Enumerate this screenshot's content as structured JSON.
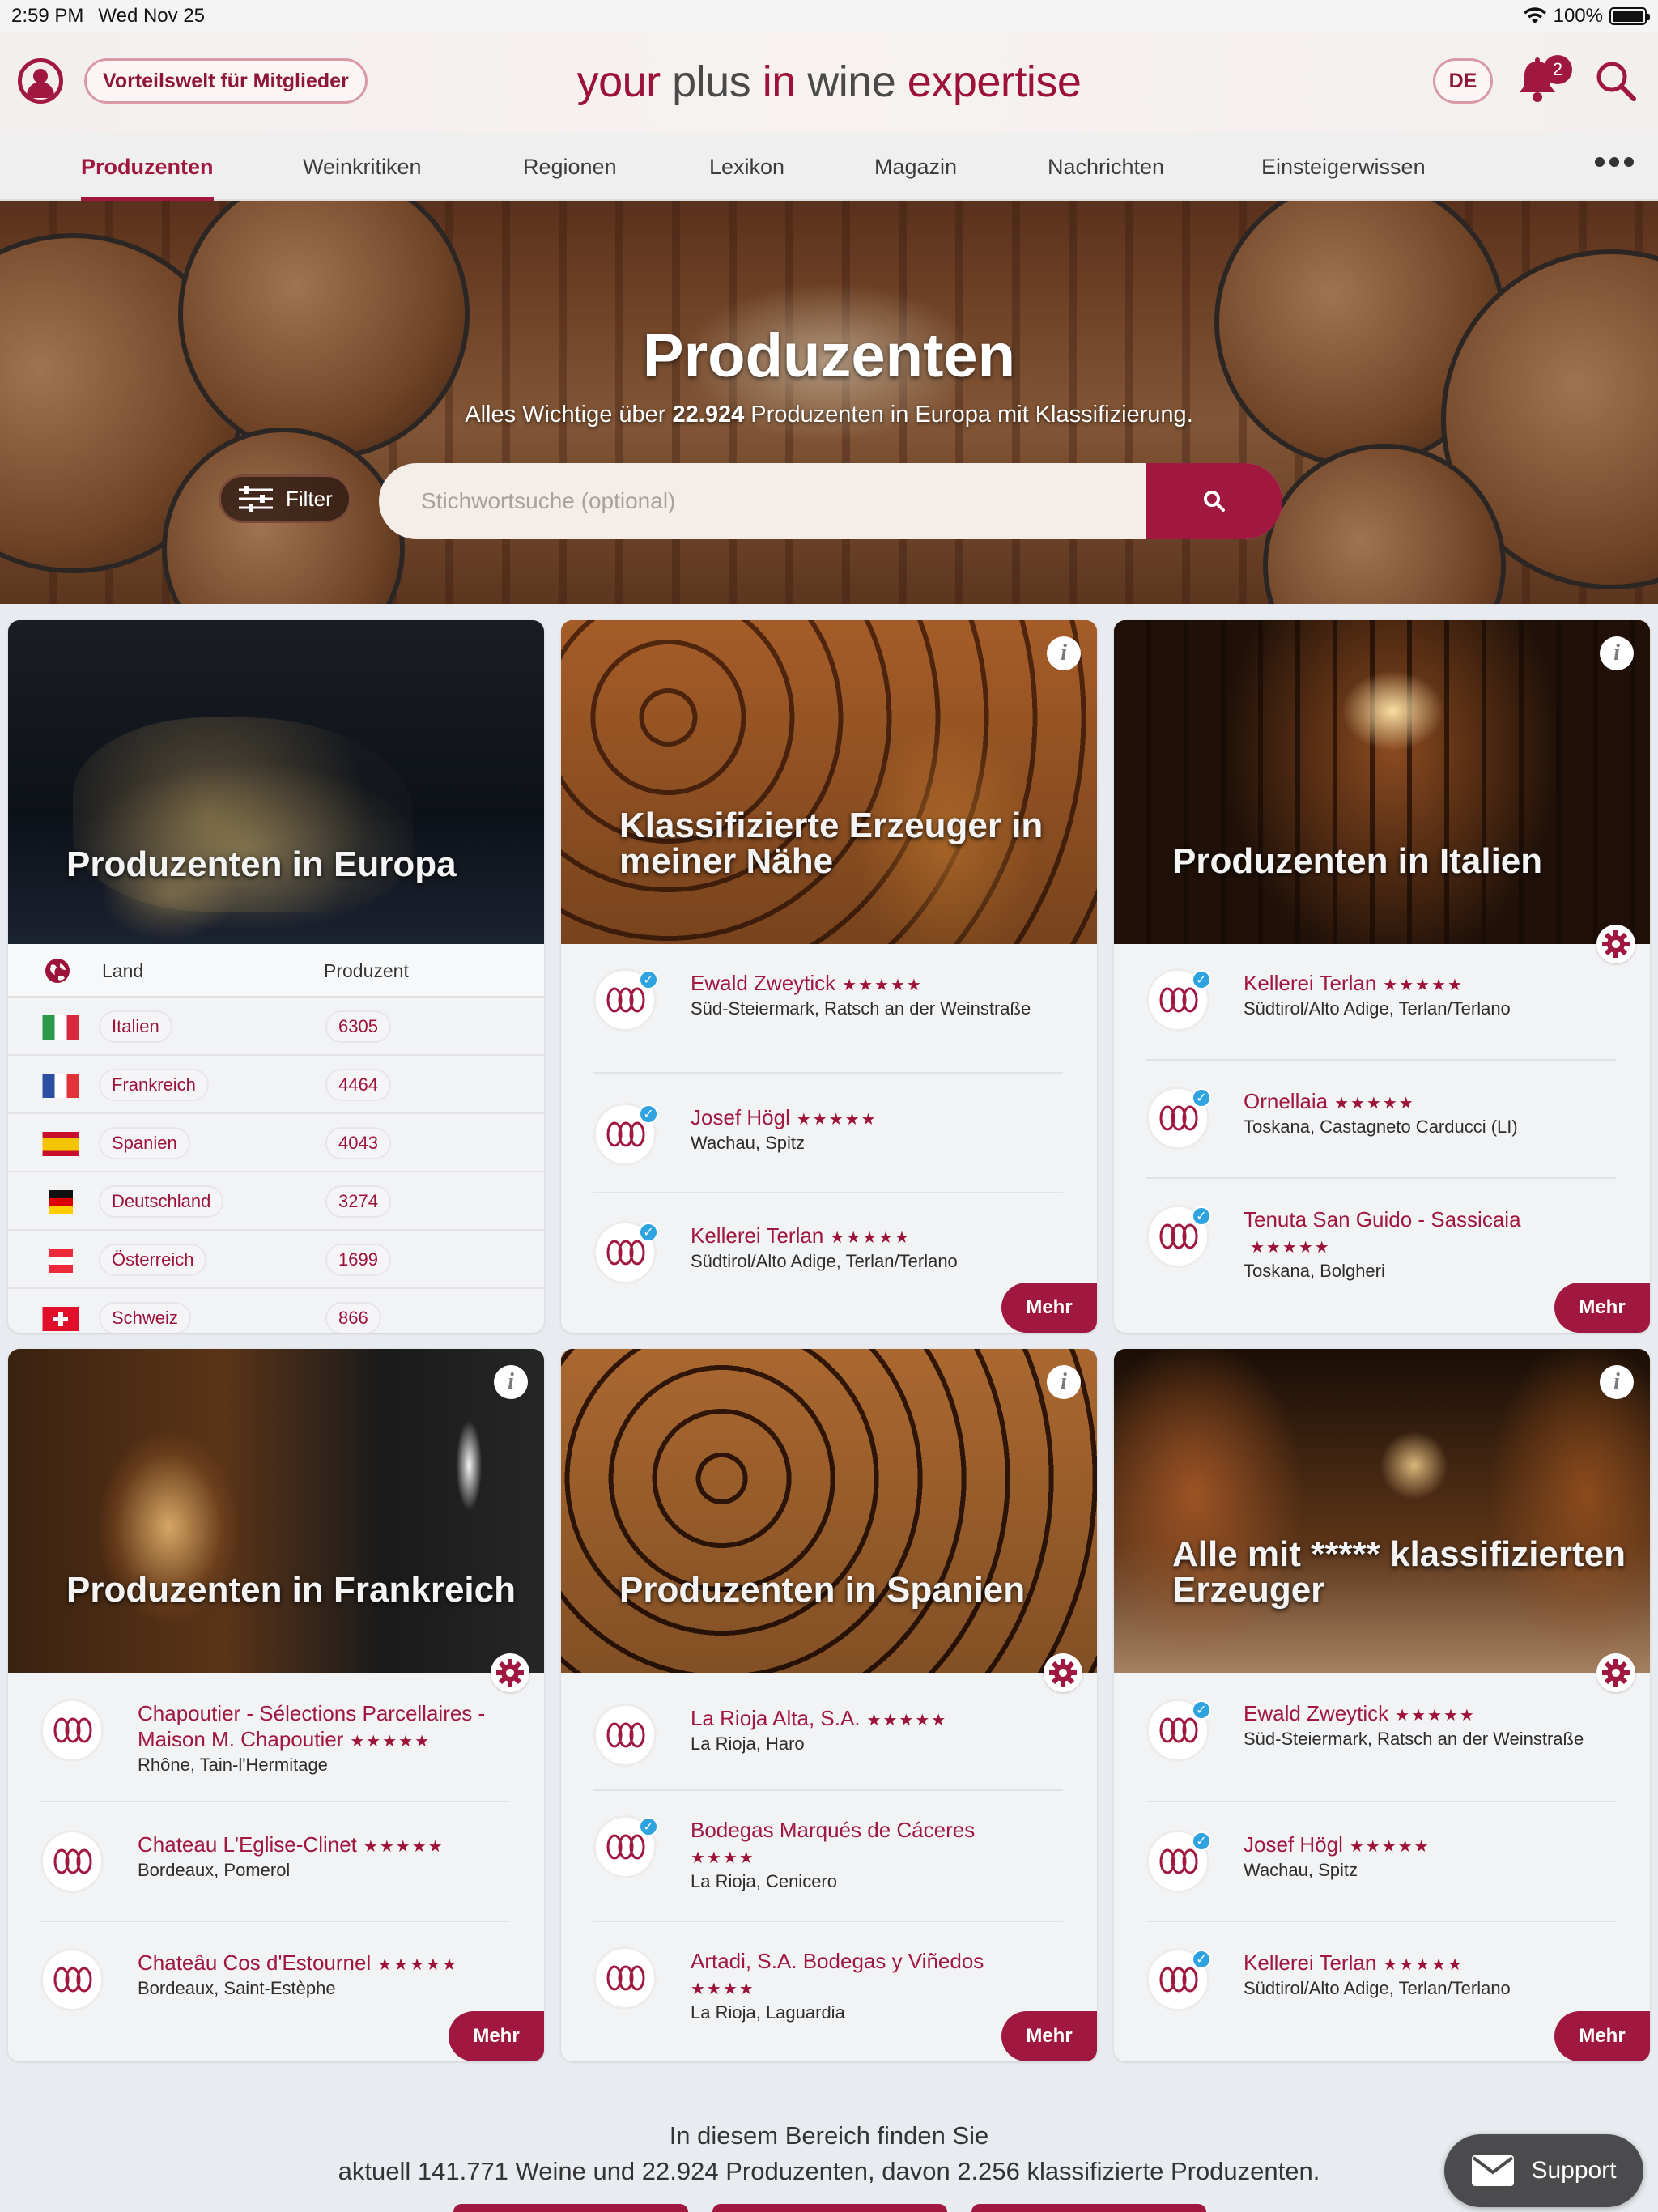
{
  "status": {
    "time": "2:59 PM",
    "date": "Wed Nov 25",
    "battery": "100%"
  },
  "header": {
    "member_label": "Vorteilswelt für Mitglieder",
    "brand_part1": "your ",
    "brand_part2": "plus",
    "brand_part3": " in ",
    "brand_part4": "wine",
    "brand_part5": " expertise",
    "lang": "DE",
    "notification_count": "2"
  },
  "nav": {
    "items": [
      "Produzenten",
      "Weinkritiken",
      "Regionen",
      "Lexikon",
      "Magazin",
      "Nachrichten",
      "Einsteigerwissen"
    ]
  },
  "hero": {
    "title": "Produzenten",
    "subtitle_pre": "Alles Wichtige über ",
    "subtitle_count": "22.924",
    "subtitle_post": " Produzenten in Europa mit Klassifizierung.",
    "filter_label": "Filter",
    "search_placeholder": "Stichwortsuche (optional)"
  },
  "europe": {
    "title": "Produzenten in Europa",
    "col_country": "Land",
    "col_producer": "Produzent",
    "rows": [
      {
        "country": "Italien",
        "count": "6305"
      },
      {
        "country": "Frankreich",
        "count": "4464"
      },
      {
        "country": "Spanien",
        "count": "4043"
      },
      {
        "country": "Deutschland",
        "count": "3274"
      },
      {
        "country": "Österreich",
        "count": "1699"
      },
      {
        "country": "Schweiz",
        "count": "866"
      }
    ]
  },
  "cards": {
    "nearby": {
      "title": "Klassifizierte Erzeuger in meiner Nähe",
      "entries": [
        {
          "name": "Ewald Zweytick",
          "stars": "★★★★★",
          "loc": "Süd-Steiermark, Ratsch an der Weinstraße"
        },
        {
          "name": "Josef Högl",
          "stars": "★★★★★",
          "loc": "Wachau, Spitz"
        },
        {
          "name": "Kellerei Terlan",
          "stars": "★★★★★",
          "loc": "Südtirol/Alto Adige, Terlan/Terlano"
        }
      ]
    },
    "italy": {
      "title": "Produzenten in Italien",
      "entries": [
        {
          "name": "Kellerei Terlan",
          "stars": "★★★★★",
          "loc": "Südtirol/Alto Adige, Terlan/Terlano"
        },
        {
          "name": "Ornellaia",
          "stars": "★★★★★",
          "loc": "Toskana, Castagneto Carducci (LI)"
        },
        {
          "name": "Tenuta San Guido - Sassicaia",
          "stars": "★★★★★",
          "loc": "Toskana, Bolgheri"
        }
      ]
    },
    "france": {
      "title": "Produzenten in Frankreich",
      "entries": [
        {
          "name": "Chapoutier - Sélections Parcellaires - Maison M. Chapoutier",
          "stars": "★★★★★",
          "loc": "Rhône, Tain-l'Hermitage"
        },
        {
          "name": "Chateau L'Eglise-Clinet",
          "stars": "★★★★★",
          "loc": "Bordeaux, Pomerol"
        },
        {
          "name": "Chateâu Cos d'Estournel",
          "stars": "★★★★★",
          "loc": "Bordeaux, Saint-Estèphe"
        }
      ]
    },
    "spain": {
      "title": "Produzenten in Spanien",
      "entries": [
        {
          "name": "La Rioja Alta, S.A.",
          "stars": "★★★★★",
          "loc": "La Rioja, Haro"
        },
        {
          "name": "Bodegas Marqués de Cáceres",
          "stars": "★★★★",
          "loc": "La Rioja, Cenicero"
        },
        {
          "name": "Artadi, S.A. Bodegas y Viñedos",
          "stars": "★★★★",
          "loc": "La Rioja, Laguardia"
        }
      ]
    },
    "classified": {
      "title": "Alle mit ***** klassifizierten Erzeuger",
      "entries": [
        {
          "name": "Ewald Zweytick",
          "stars": "★★★★★",
          "loc": "Süd-Steiermark, Ratsch an der Weinstraße"
        },
        {
          "name": "Josef Högl",
          "stars": "★★★★★",
          "loc": "Wachau, Spitz"
        },
        {
          "name": "Kellerei Terlan",
          "stars": "★★★★★",
          "loc": "Südtirol/Alto Adige, Terlan/Terlano"
        }
      ]
    },
    "more_label": "Mehr"
  },
  "footer": {
    "line1": "In diesem Bereich finden Sie",
    "line2": "aktuell 141.771 Weine und 22.924 Produzenten, davon 2.256 klassifizierte Produzenten.",
    "support_label": "Support"
  },
  "colors": {
    "accent": "#a0173f",
    "brand": "#9c1238"
  }
}
